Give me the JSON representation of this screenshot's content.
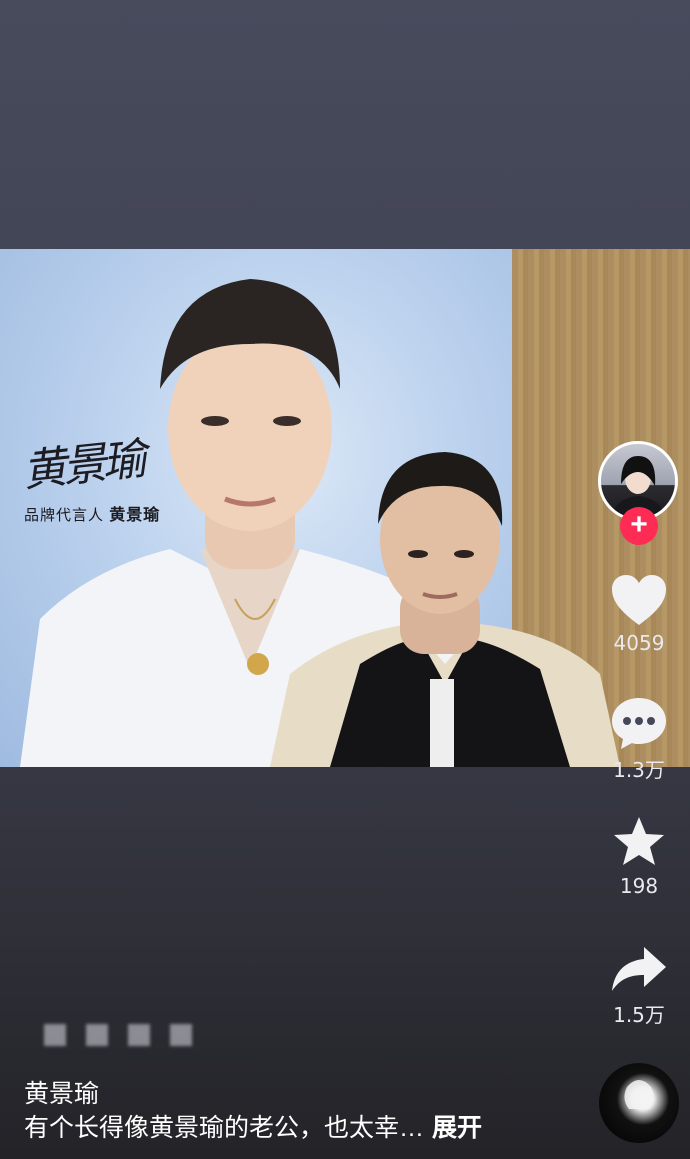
{
  "ad": {
    "spokesperson_label": "品牌代言人",
    "spokesperson_name": "黄景瑜"
  },
  "actions": {
    "like_count": "4059",
    "comment_count": "1.3万",
    "favorite_count": "198",
    "share_count": "1.5万"
  },
  "post": {
    "title": "黄景瑜",
    "caption": "有个长得像黄景瑜的老公，也太幸…",
    "expand_label": "展开"
  },
  "icons": {
    "follow": "plus-icon",
    "like": "heart-icon",
    "comment": "comment-bubble-icon",
    "favorite": "star-icon",
    "share": "share-arrow-icon",
    "music": "music-disc-icon"
  },
  "colors": {
    "follow_button": "#fe2c55",
    "icon_fill": "#f2f2f4"
  }
}
